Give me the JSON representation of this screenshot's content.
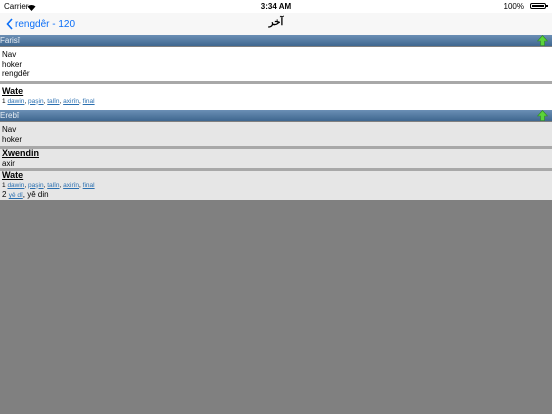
{
  "status": {
    "carrier": "Carrier",
    "time": "3:34 AM",
    "battery": "100%"
  },
  "nav": {
    "back_label": "rengdêr -  120",
    "title": "آخر"
  },
  "sections": [
    {
      "header": "Farisî",
      "pos_title": "Nav",
      "pos_lines": [
        "hoker",
        "rengdêr"
      ],
      "wate_title": "Wate",
      "wate_items": [
        {
          "num": "1",
          "links": [
            "dawin",
            "paşin",
            "talîn",
            "axirîn",
            "final"
          ],
          "extra": ""
        }
      ]
    },
    {
      "header": "Erebî",
      "pos_title": "Nav",
      "pos_lines": [
        "hoker"
      ],
      "xwendin_title": "Xwendin",
      "xwendin_value": "axir",
      "wate_title": "Wate",
      "wate_items": [
        {
          "num": "1",
          "links": [
            "dawin",
            "paşin",
            "talîn",
            "axirîn",
            "final"
          ],
          "extra": ""
        },
        {
          "num": "2",
          "links": [
            "yê dî"
          ],
          "extra": "yê din"
        }
      ]
    }
  ]
}
